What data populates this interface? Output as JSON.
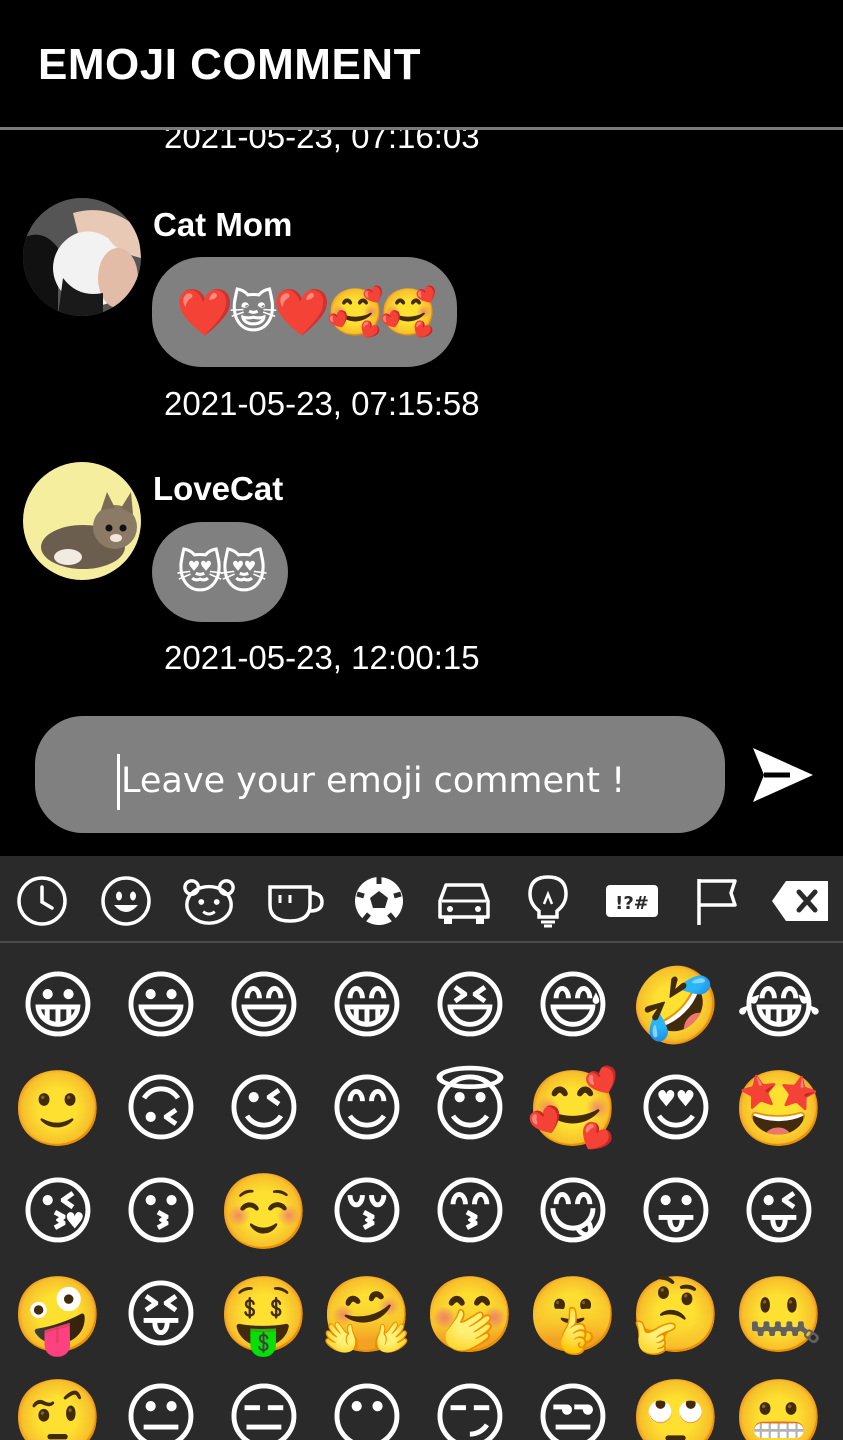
{
  "app": {
    "title": "EMOJI COMMENT"
  },
  "comments": [
    {
      "timestamp": "2021-05-23, 07:16:03"
    },
    {
      "user": "Cat Mom",
      "emojis": "❤️😺❤️🥰🥰",
      "timestamp": "2021-05-23, 07:15:58"
    },
    {
      "user": "LoveCat",
      "emojis": "😻😻",
      "timestamp": "2021-05-23, 12:00:15"
    }
  ],
  "input": {
    "placeholder": "Leave your emoji comment !"
  },
  "keyboard": {
    "categories": [
      "clock-icon",
      "smiley-icon",
      "bear-icon",
      "cup-icon",
      "soccer-ball-icon",
      "car-icon",
      "lightbulb-icon",
      "symbols-icon",
      "flag-icon",
      "backspace-icon"
    ],
    "symbols_label": "!?#",
    "emojis": [
      [
        "😀",
        "😃",
        "😄",
        "😁",
        "😆",
        "😅",
        "🤣",
        "😂"
      ],
      [
        "🙂",
        "🙃",
        "😉",
        "😊",
        "😇",
        "🥰",
        "😍",
        "🤩"
      ],
      [
        "😘",
        "😗",
        "☺️",
        "😚",
        "😙",
        "😋",
        "😛",
        "😜"
      ],
      [
        "🤪",
        "😝",
        "🤑",
        "🤗",
        "🤭",
        "🤫",
        "🤔",
        "🤐"
      ],
      [
        "🤨",
        "😐",
        "😑",
        "😶",
        "😏",
        "😒",
        "🙄",
        "😬"
      ]
    ]
  },
  "colors": {
    "background": "#000000",
    "bubble": "#808080",
    "keyboard": "#2a2a2a",
    "divider": "#7a7a7a"
  }
}
